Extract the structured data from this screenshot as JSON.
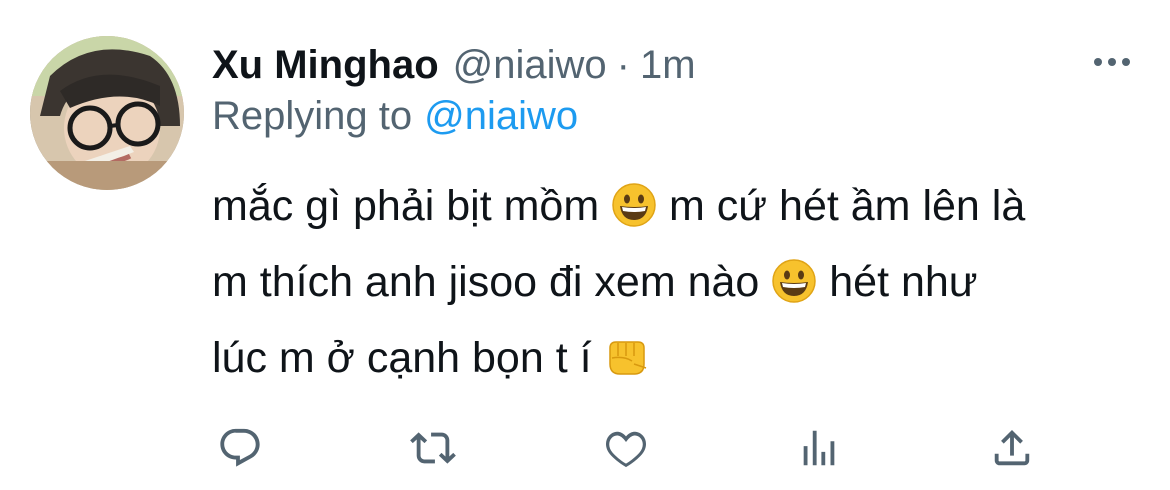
{
  "author": {
    "display_name": "Xu Minghao",
    "handle": "@niaiwo",
    "separator": "·",
    "time": "1m"
  },
  "reply": {
    "prefix": "Replying to",
    "mention": "@niaiwo"
  },
  "tweet": {
    "line1_part1": "mắc gì phải bịt mồm ",
    "line1_part2": " m cứ hét ầm lên là",
    "line2_part1": "m thích anh jisoo đi xem nào ",
    "line2_part2": " hét như",
    "line3_part1": "lúc m ở cạnh bọn t í ",
    "emojis": [
      "grinning-face",
      "grinning-face",
      "oncoming-fist"
    ]
  },
  "actions": [
    "reply-icon",
    "retweet-icon",
    "like-icon",
    "analytics-icon",
    "share-icon"
  ],
  "colors": {
    "text": "#0f1419",
    "secondary": "#536471",
    "link": "#1d9bf0",
    "icon": "#536471"
  }
}
